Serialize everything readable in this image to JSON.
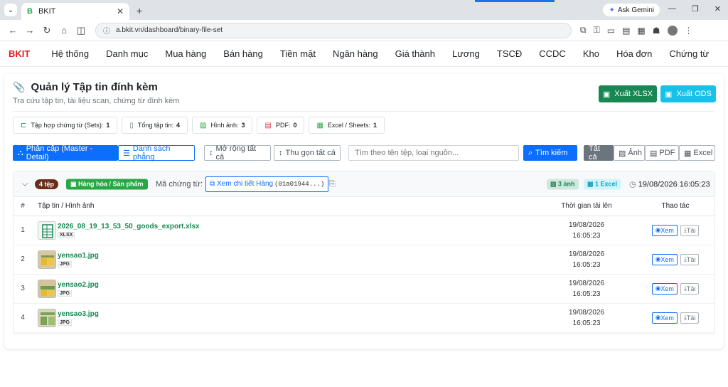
{
  "browser": {
    "tab_title": "BKIT",
    "tab_favicon": "B",
    "url": "a.bkit.vn/dashboard/binary-file-set",
    "gemini_label": "Ask Gemini"
  },
  "nav": {
    "brand": "BKIT",
    "items": [
      "Hệ thống",
      "Danh mục",
      "Mua hàng",
      "Bán hàng",
      "Tiền mặt",
      "Ngân hàng",
      "Giá thành",
      "Lương",
      "TSCĐ",
      "CCDC",
      "Kho",
      "Hóa đơn",
      "Chứng từ"
    ]
  },
  "page": {
    "title": "Quản lý Tập tin đính kèm",
    "subtitle": "Tra cứu tập tin, tài liệu scan, chứng từ đính kèm",
    "export_xlsx": "Xuất XLSX",
    "export_ods": "Xuất ODS"
  },
  "stats": [
    {
      "label": "Tập hợp chứng từ (Sets):",
      "value": "1",
      "icon": "folder-icon",
      "color": "#28a745"
    },
    {
      "label": "Tổng tập tin:",
      "value": "4",
      "icon": "file-icon",
      "color": "#6c757d"
    },
    {
      "label": "Hình ảnh:",
      "value": "3",
      "icon": "image-icon",
      "color": "#28a745"
    },
    {
      "label": "PDF:",
      "value": "0",
      "icon": "pdf-icon",
      "color": "#dc3545"
    },
    {
      "label": "Excel / Sheets:",
      "value": "1",
      "icon": "excel-icon",
      "color": "#28a745"
    }
  ],
  "toolbar": {
    "view_tree": "Phân cấp (Master - Detail)",
    "view_list": "Danh sách phẳng",
    "expand_all": "Mở rộng tất cả",
    "collapse_all": "Thu gọn tất cả",
    "search_placeholder": "Tìm theo tên tệp, loại nguồn...",
    "search_button": "Tìm kiếm",
    "filter_all": "Tất cả",
    "filter_image": "Ảnh",
    "filter_pdf": "PDF",
    "filter_excel": "Excel"
  },
  "group": {
    "count_badge": "4 tệp",
    "category_badge": "Hàng hóa / Sản phẩm",
    "voucher_label": "Mã chứng từ:",
    "detail_link": "Xem chi tiết Hàng",
    "detail_id": "(01a01944...)",
    "image_badge": "3 ảnh",
    "excel_badge": "1 Excel",
    "timestamp": "19/08/2026 16:05:23"
  },
  "table": {
    "headers": {
      "num": "#",
      "file": "Tập tin / Hình ảnh",
      "time": "Thời gian tải lên",
      "actions": "Thao tác"
    },
    "view_label": "Xem",
    "download_label": "Tải",
    "rows": [
      {
        "num": "1",
        "name": "2026_08_19_13_53_50_goods_export.xlsx",
        "ext": "XLSX",
        "date": "19/08/2026",
        "time": "16:05:23"
      },
      {
        "num": "2",
        "name": "yensao1.jpg",
        "ext": "JPG",
        "date": "19/08/2026",
        "time": "16:05:23"
      },
      {
        "num": "3",
        "name": "yensao2.jpg",
        "ext": "JPG",
        "date": "19/08/2026",
        "time": "16:05:23"
      },
      {
        "num": "4",
        "name": "yensao3.jpg",
        "ext": "JPG",
        "date": "19/08/2026",
        "time": "16:05:23"
      }
    ]
  }
}
